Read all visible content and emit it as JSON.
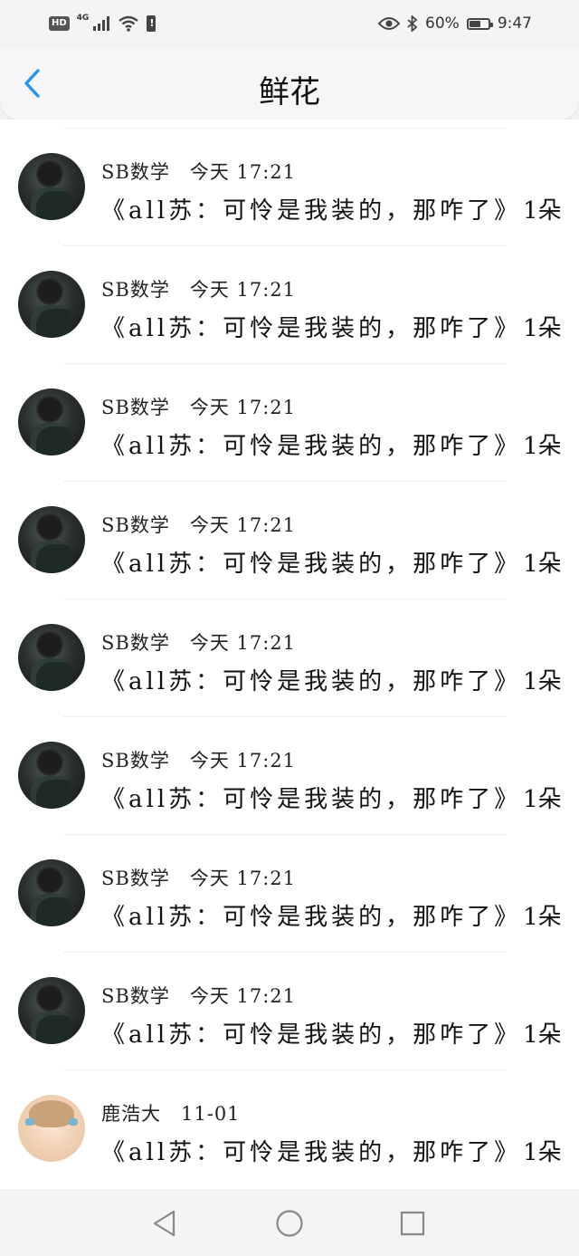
{
  "status_bar": {
    "hd": "HD",
    "network": "4G",
    "battery_percent": "60%",
    "battery_level": 0.6,
    "time": "9:47",
    "icons": [
      "hd-icon",
      "signal-icon",
      "wifi-icon",
      "battery-alert-icon",
      "eye-icon",
      "bluetooth-icon",
      "battery-icon"
    ]
  },
  "header": {
    "title": "鲜花",
    "back_icon": "chevron-left-icon",
    "accent_color": "#2196f3"
  },
  "items": [
    {
      "name": "SB数学",
      "time": "今天 17:21",
      "text": "《all苏：可怜是我装的，那咋了》",
      "count": "1朵",
      "avatar": "dark"
    },
    {
      "name": "SB数学",
      "time": "今天 17:21",
      "text": "《all苏：可怜是我装的，那咋了》",
      "count": "1朵",
      "avatar": "dark"
    },
    {
      "name": "SB数学",
      "time": "今天 17:21",
      "text": "《all苏：可怜是我装的，那咋了》",
      "count": "1朵",
      "avatar": "dark"
    },
    {
      "name": "SB数学",
      "time": "今天 17:21",
      "text": "《all苏：可怜是我装的，那咋了》",
      "count": "1朵",
      "avatar": "dark"
    },
    {
      "name": "SB数学",
      "time": "今天 17:21",
      "text": "《all苏：可怜是我装的，那咋了》",
      "count": "1朵",
      "avatar": "dark"
    },
    {
      "name": "SB数学",
      "time": "今天 17:21",
      "text": "《all苏：可怜是我装的，那咋了》",
      "count": "1朵",
      "avatar": "dark"
    },
    {
      "name": "SB数学",
      "time": "今天 17:21",
      "text": "《all苏：可怜是我装的，那咋了》",
      "count": "1朵",
      "avatar": "dark"
    },
    {
      "name": "SB数学",
      "time": "今天 17:21",
      "text": "《all苏：可怜是我装的，那咋了》",
      "count": "1朵",
      "avatar": "dark"
    },
    {
      "name": "鹿浩大",
      "time": "11-01",
      "text": "《all苏：可怜是我装的，那咋了》",
      "count": "1朵",
      "avatar": "light"
    }
  ],
  "nav_bar": {
    "icons": [
      "back-triangle-icon",
      "home-circle-icon",
      "recents-square-icon"
    ]
  }
}
